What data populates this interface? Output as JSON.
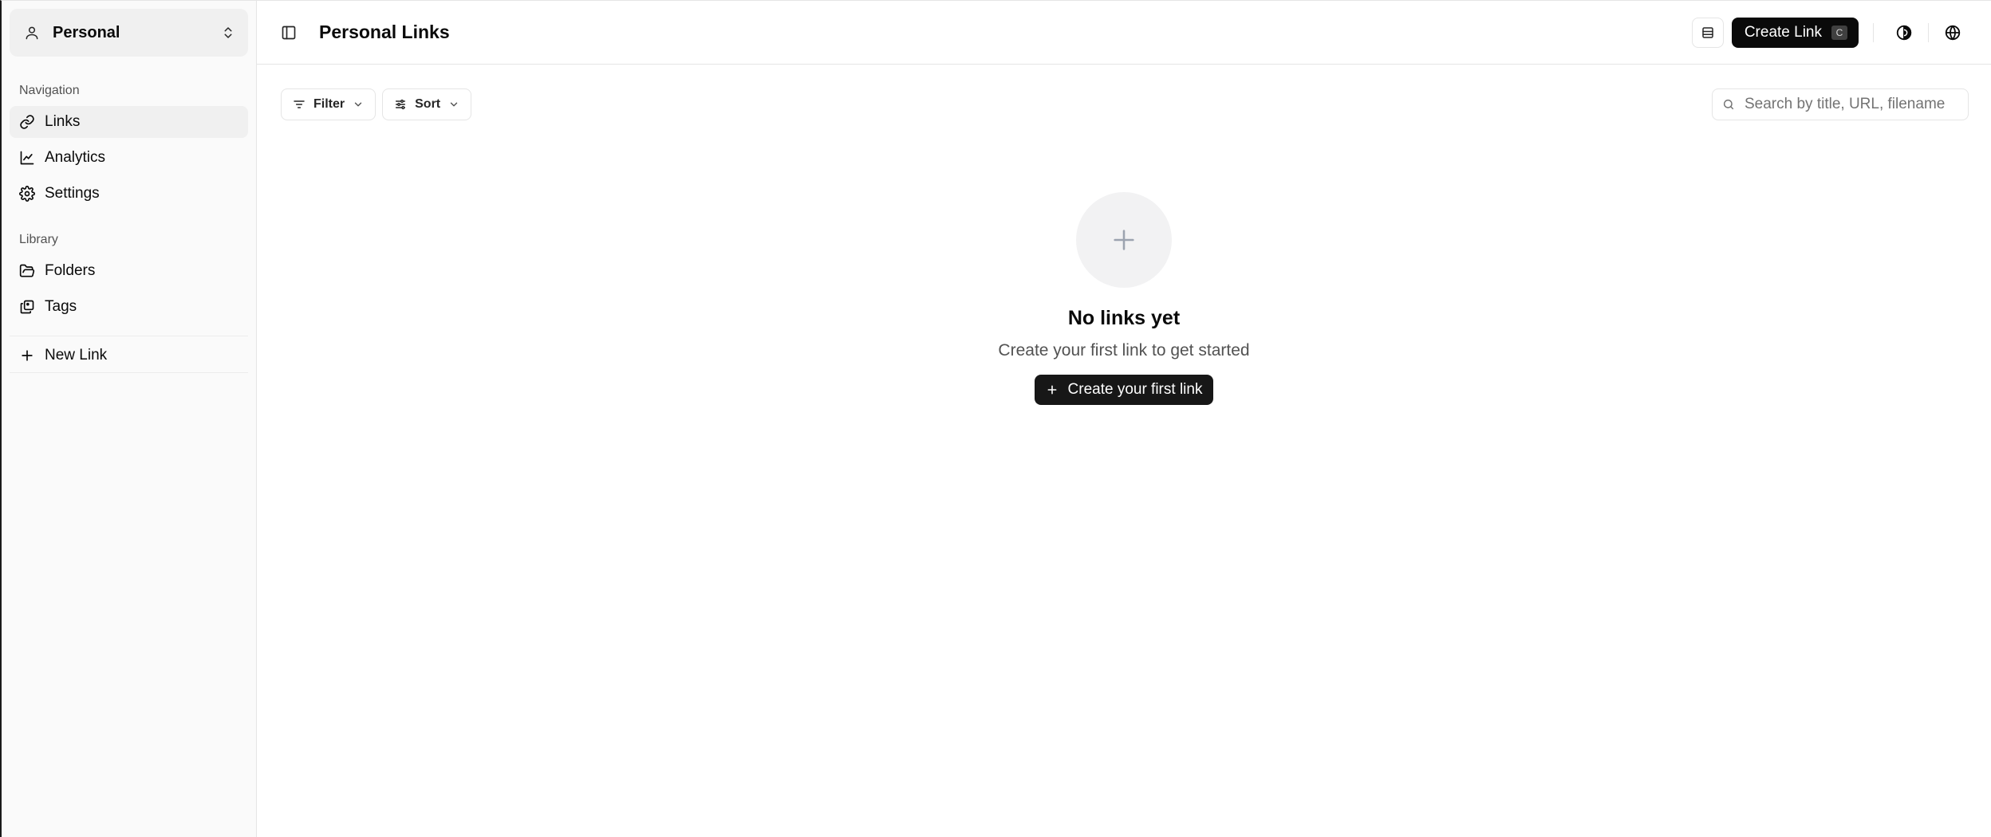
{
  "workspace": {
    "name": "Personal"
  },
  "sidebar": {
    "navigation_label": "Navigation",
    "navigation": [
      {
        "label": "Links",
        "icon": "link-icon",
        "active": true
      },
      {
        "label": "Analytics",
        "icon": "chart-line-icon"
      },
      {
        "label": "Settings",
        "icon": "gear-icon"
      }
    ],
    "library_label": "Library",
    "library": [
      {
        "label": "Folders",
        "icon": "folder-open-icon"
      },
      {
        "label": "Tags",
        "icon": "tags-icon"
      }
    ],
    "new_link_label": "New Link"
  },
  "header": {
    "title": "Personal Links",
    "create_link_label": "Create Link",
    "create_link_shortcut": "C"
  },
  "toolbar": {
    "filter_label": "Filter",
    "sort_label": "Sort",
    "search_placeholder": "Search by title, URL, filename"
  },
  "empty_state": {
    "title": "No links yet",
    "subtitle": "Create your first link to get started",
    "cta_label": "Create your first link"
  },
  "colors": {
    "primary": "#0a0a0a",
    "sidebar_bg": "#fafafa",
    "border": "#e5e5e5",
    "muted_text": "#525252"
  }
}
